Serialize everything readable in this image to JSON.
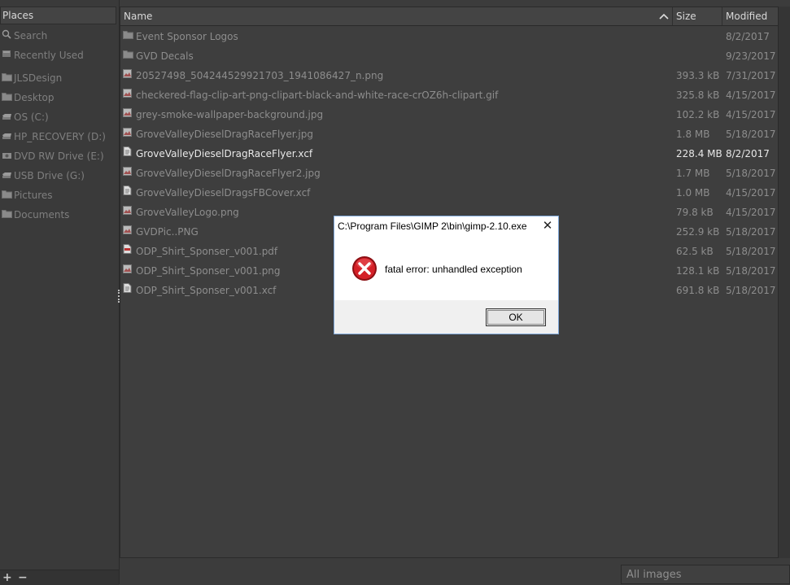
{
  "places": {
    "header": "Places",
    "items": [
      {
        "label": "Search",
        "icon": "search-icon"
      },
      {
        "label": "Recently Used",
        "icon": "recent-icon"
      },
      {
        "label": "JLSDesign",
        "icon": "folder-icon"
      },
      {
        "label": "Desktop",
        "icon": "folder-icon"
      },
      {
        "label": "OS (C:)",
        "icon": "drive-icon"
      },
      {
        "label": "HP_RECOVERY (D:)",
        "icon": "drive-icon"
      },
      {
        "label": "DVD RW Drive (E:)",
        "icon": "optical-drive-icon"
      },
      {
        "label": "USB Drive (G:)",
        "icon": "drive-icon"
      },
      {
        "label": "Pictures",
        "icon": "folder-icon"
      },
      {
        "label": "Documents",
        "icon": "folder-icon"
      }
    ],
    "add_symbol": "+",
    "remove_symbol": "−"
  },
  "columns": {
    "name": "Name",
    "size": "Size",
    "modified": "Modified",
    "sort_indicator": "^"
  },
  "files": [
    {
      "name": "Event Sponsor Logos",
      "size": "",
      "modified": "8/2/2017",
      "icon": "folder-icon"
    },
    {
      "name": "GVD Decals",
      "size": "",
      "modified": "9/23/2017",
      "icon": "folder-icon"
    },
    {
      "name": "20527498_504244529921703_1941086427_n.png",
      "size": "393.3 kB",
      "modified": "7/31/2017",
      "icon": "image-icon"
    },
    {
      "name": "checkered-flag-clip-art-png-clipart-black-and-white-race-crOZ6h-clipart.gif",
      "size": "325.8 kB",
      "modified": "4/15/2017",
      "icon": "image-icon"
    },
    {
      "name": "grey-smoke-wallpaper-background.jpg",
      "size": "102.2 kB",
      "modified": "4/15/2017",
      "icon": "image-icon"
    },
    {
      "name": "GroveValleyDieselDragRaceFlyer.jpg",
      "size": "1.8 MB",
      "modified": "5/18/2017",
      "icon": "image-icon"
    },
    {
      "name": "GroveValleyDieselDragRaceFlyer.xcf",
      "size": "228.4 MB",
      "modified": "8/2/2017",
      "icon": "xcf-icon",
      "selected": true
    },
    {
      "name": "GroveValleyDieselDragRaceFlyer2.jpg",
      "size": "1.7 MB",
      "modified": "5/18/2017",
      "icon": "image-icon"
    },
    {
      "name": "GroveValleyDieselDragsFBCover.xcf",
      "size": "1.0 MB",
      "modified": "4/15/2017",
      "icon": "xcf-icon"
    },
    {
      "name": "GroveValleyLogo.png",
      "size": "79.8 kB",
      "modified": "4/15/2017",
      "icon": "image-icon"
    },
    {
      "name": "GVDPic..PNG",
      "size": "252.9 kB",
      "modified": "5/18/2017",
      "icon": "image-icon"
    },
    {
      "name": "ODP_Shirt_Sponser_v001.pdf",
      "size": "62.5 kB",
      "modified": "5/18/2017",
      "icon": "pdf-icon"
    },
    {
      "name": "ODP_Shirt_Sponser_v001.png",
      "size": "128.1 kB",
      "modified": "5/18/2017",
      "icon": "image-icon"
    },
    {
      "name": "ODP_Shirt_Sponser_v001.xcf",
      "size": "691.8 kB",
      "modified": "5/18/2017",
      "icon": "xcf-icon"
    }
  ],
  "filter": {
    "value": "All images"
  },
  "dialog": {
    "title": "C:\\Program Files\\GIMP 2\\bin\\gimp-2.10.exe",
    "message": "fatal error: unhandled exception",
    "ok_label": "OK",
    "close_symbol": "✕",
    "icon": "error-icon",
    "error_color": "#c4161c"
  }
}
